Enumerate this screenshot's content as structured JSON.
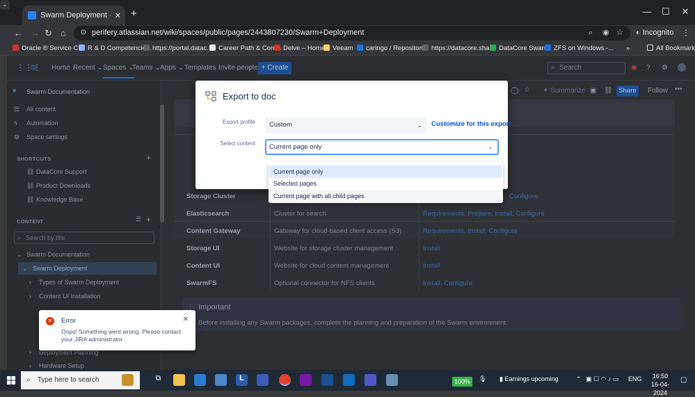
{
  "browser": {
    "tab_title": "Swarm Deployment - Swarm Do",
    "url": "perifery.atlassian.net/wiki/spaces/public/pages/2443807230/Swarm+Deployment",
    "incognito_label": "Incognito",
    "bookmarks": [
      "Oracle ® Service Cl...",
      "R & D Competencie...",
      "https://portal.datac...",
      "Career Path & Com...",
      "Delve – Home",
      "Veeam",
      "caringo / Repositori...",
      "https://datacore.sha...",
      "DataCore Swarm",
      "ZFS on Windows -..."
    ],
    "all_bookmarks": "All Bookmarks"
  },
  "topnav": {
    "items": [
      "Home",
      "Recent",
      "Spaces",
      "Teams",
      "Apps",
      "Templates",
      "Invite people"
    ],
    "create_label": "+ Create",
    "search_placeholder": "Search"
  },
  "sidebar": {
    "space_name": "Swarm Documentation",
    "links": [
      "All content",
      "Automation",
      "Space settings"
    ],
    "shortcuts_header": "SHORTCUTS",
    "shortcuts": [
      "DataCore Support",
      "Product Downloads",
      "Knowledge Base"
    ],
    "content_header": "CONTENT",
    "filter_placeholder": "Search by title",
    "tree": [
      "Swarm Documentation",
      "Swarm Deployment",
      "Types of Swarm Deployment",
      "Content UI Installation",
      "Deployment Planning",
      "Hardware Setup"
    ]
  },
  "page": {
    "actions": [
      "Summarize",
      "Share",
      "Follow"
    ],
    "table": [
      {
        "name": "Storage Cluster",
        "desc": "",
        "links": "Requirements, Prepare, Install, Configure"
      },
      {
        "name": "Elasticsearch",
        "desc": "Cluster for search",
        "links": "Requirements, Prepare, Install, Configure"
      },
      {
        "name": "Content Gateway",
        "desc": "Gateway for cloud-based client access (S3)",
        "links": "Requirements, Install, Configure"
      },
      {
        "name": "Storage UI",
        "desc": "Website for storage cluster management",
        "links": "Install"
      },
      {
        "name": "Content UI",
        "desc": "Website for cloud content management",
        "links": "Install"
      },
      {
        "name": "SwarmFS",
        "desc": "Optional connector for NFS clients",
        "links": "Install, Configure"
      }
    ],
    "important_title": "Important",
    "important_text": "Before installing any Swarm packages, complete the planning and preparation of the Swarm environment."
  },
  "modal": {
    "title": "Export to doc",
    "profile_label": "Export profile",
    "profile_value": "Custom",
    "customize_link": "Customize for this export",
    "content_label": "Select content",
    "content_value": "Current page only",
    "options": [
      "Current page only",
      "Selected pages",
      "Current page with all child pages"
    ]
  },
  "toast": {
    "title": "Error",
    "message": "Oops! Something went wrong. Please contact your JIRA administrator."
  },
  "taskbar": {
    "search_placeholder": "Type here to search",
    "battery": "100%",
    "news": "Earnings upcoming",
    "lang": "ENG",
    "time": "16:50",
    "date": "16-04-2024"
  },
  "colors": {
    "accent": "#0052cc",
    "focus": "#4c9aff",
    "error": "#de350b",
    "selected_option": "#deebff"
  }
}
